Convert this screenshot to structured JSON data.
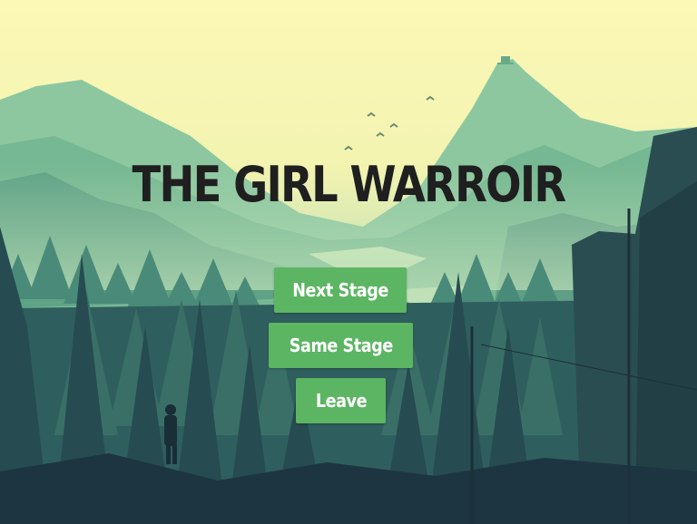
{
  "game": {
    "title": "THE GIRL WARROIR",
    "menu": {
      "next_stage": "Next Stage",
      "same_stage": "Same Stage",
      "leave": "Leave"
    }
  },
  "colors": {
    "sky": "#fbf7b0",
    "title_text": "#1f1f1f",
    "button_bg": "#5cb562",
    "button_text": "#ffffff",
    "mountain_far": "#7fbf9a",
    "forest_dark": "#1f3a40"
  }
}
